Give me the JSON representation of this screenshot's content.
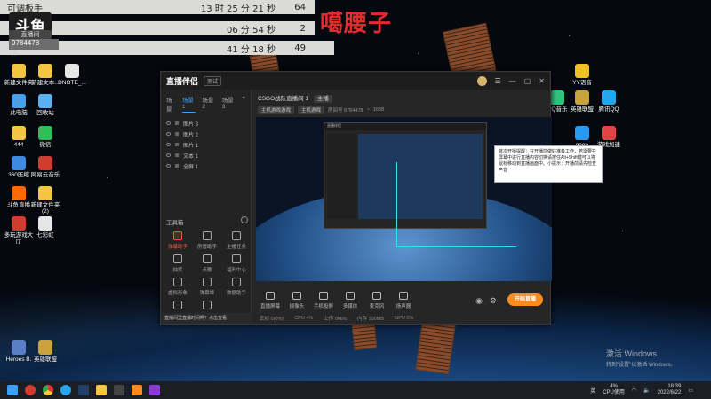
{
  "overlay": {
    "rows": [
      {
        "name": "可调板手",
        "time": "13 时 25 分 21 秒",
        "count": "64"
      },
      {
        "name": "",
        "time": "06 分 54 秒",
        "count": "2"
      },
      {
        "name": "",
        "time": "41 分 18 秒",
        "count": "49"
      }
    ],
    "logo_text": "斗鱼",
    "room_tag": "直播间",
    "room_no": "9784478",
    "side_note": "(4)"
  },
  "watermark": "噶腰子",
  "desktop_icons_left": [
    {
      "label": "新建文件夹",
      "color": "#f4c542"
    },
    {
      "label": "新建文本...",
      "color": "#f4c542"
    },
    {
      "label": "DNOTE_...",
      "color": "#e6e6e6"
    },
    {
      "label": "此电脑",
      "color": "#4aa0e6"
    },
    {
      "label": "回收站",
      "color": "#5ab0f0"
    },
    {
      "label": "444",
      "color": "#f4c542"
    },
    {
      "label": "微信",
      "color": "#2fbf5a"
    },
    {
      "label": "360压缩",
      "color": "#3d8be0"
    },
    {
      "label": "网易云音乐",
      "color": "#d33a31"
    },
    {
      "label": "斗鱼直播",
      "color": "#ff6a00"
    },
    {
      "label": "新建文件夹 (2)",
      "color": "#f4c542"
    },
    {
      "label": "多玩游戏大厅",
      "color": "#d23c2e"
    },
    {
      "label": "七彩虹",
      "color": "#e6e6e6"
    },
    {
      "label": "Heroes B.",
      "color": "#5b7ec9"
    },
    {
      "label": "英雄联盟",
      "color": "#c9a23e"
    }
  ],
  "desktop_icons_right": [
    {
      "label": "YY语音",
      "color": "#f0c02a"
    },
    {
      "label": "英雄联盟",
      "color": "#c9a23e"
    },
    {
      "label": "QQ音乐",
      "color": "#31c27c"
    },
    {
      "label": "腾讯QQ",
      "color": "#25a5ec"
    },
    {
      "label": "gaga",
      "color": "#2a9af0"
    },
    {
      "label": "游戏加速",
      "color": "#e14444"
    }
  ],
  "app": {
    "title": "直播伴侣",
    "version": "测试",
    "scene_tabs": [
      "场景",
      "场景 1",
      "场景 2",
      "场景 3"
    ],
    "sources": [
      "图片 3",
      "图片 2",
      "图片 1",
      "文本 1",
      "全屏 1"
    ],
    "tools_title": "工具箱",
    "tools": [
      {
        "label": "弹幕助手",
        "active": true
      },
      {
        "label": "房管助手",
        "active": false
      },
      {
        "label": "主播任务",
        "active": false
      },
      {
        "label": "抽奖",
        "active": false
      },
      {
        "label": "点歌",
        "active": false
      },
      {
        "label": "福利中心",
        "active": false
      },
      {
        "label": "虚拟形象",
        "active": false
      },
      {
        "label": "弹幕姬",
        "active": false
      },
      {
        "label": "数据助手",
        "active": false
      },
      {
        "label": "直播间",
        "active": false
      },
      {
        "label": "互动",
        "active": false
      }
    ],
    "notice": "直播间里直播时间啊？点击查看",
    "channel": {
      "name": "CSGO战队直播间 1",
      "badge": "主播",
      "row2_chips": [
        "主机游戏游戏",
        "主机游戏"
      ],
      "row2_text": "房间号 9784478",
      "viewers": "1658"
    },
    "controls": [
      {
        "label": "直播屏幕"
      },
      {
        "label": "摄像头"
      },
      {
        "label": "手机投屏"
      },
      {
        "label": "多媒体"
      },
      {
        "label": "麦克风"
      },
      {
        "label": "扬声器"
      }
    ],
    "start_button": "开始直播",
    "stats": [
      "丢帧 0(0%)",
      "CPU 4%",
      "上传 0kb/s",
      "内存 100MB",
      "GPU 0%"
    ]
  },
  "tooltip": "首次开播提醒：在开播前做好准备工作，若需要在屏幕中进行直播内容切换请按住Alt+Shift键可以将鼠标移动到直播画面中。小提示：开播前请先检查声音",
  "activate": {
    "line1": "激活 Windows",
    "line2": "转到\"设置\"以激活 Windows。"
  },
  "taskbar": {
    "tray_text": "4%\nCPU使用",
    "ime": "英",
    "time": "18:39",
    "date": "2022/6/22"
  },
  "colors": {
    "accent": "#ff8a1e",
    "active_tool": "#e85a3a",
    "watermark": "#e02c2c"
  }
}
